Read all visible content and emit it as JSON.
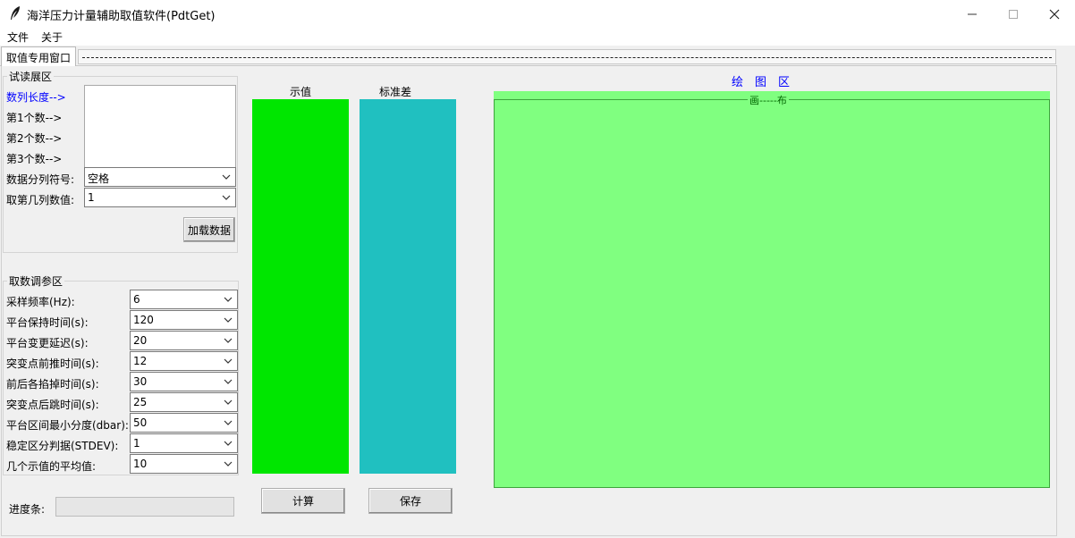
{
  "window": {
    "title": "海洋压力计量辅助取值软件(PdtGet)"
  },
  "menu": {
    "file": "文件",
    "about": "关于"
  },
  "tab": {
    "label": "取值专用窗口"
  },
  "trial_area": {
    "title": "试读展区",
    "length_label": "数列长度-->",
    "first_label": "第1个数-->",
    "second_label": "第2个数-->",
    "third_label": "第3个数-->",
    "separator_label": "数据分列符号:",
    "separator_value": "空格",
    "column_label": "取第几列数值:",
    "column_value": "1",
    "load_button": "加载数据"
  },
  "params_area": {
    "title": "取数调参区",
    "rows": [
      {
        "label": "采样频率(Hz):",
        "value": "6"
      },
      {
        "label": "平台保持时间(s):",
        "value": "120"
      },
      {
        "label": "平台变更延迟(s):",
        "value": "20"
      },
      {
        "label": "突变点前推时间(s):",
        "value": "12"
      },
      {
        "label": "前后各掐掉时间(s):",
        "value": "30"
      },
      {
        "label": "突变点后跳时间(s):",
        "value": "25"
      },
      {
        "label": "平台区间最小分度(dbar):",
        "value": "50"
      },
      {
        "label": "稳定区分判据(STDEV):",
        "value": "1"
      },
      {
        "label": "几个示值的平均值:",
        "value": "10"
      }
    ]
  },
  "progress": {
    "label": "进度条:",
    "value": 0
  },
  "results": {
    "indication_header": "示值",
    "stdev_header": "标准差",
    "calc_button": "计算",
    "save_button": "保存"
  },
  "plot": {
    "header": "绘　图　区",
    "canvas_title": "画-----布"
  },
  "colors": {
    "indication_panel": "#00e600",
    "stdev_panel": "#20c0c0",
    "canvas": "#80ff80"
  }
}
